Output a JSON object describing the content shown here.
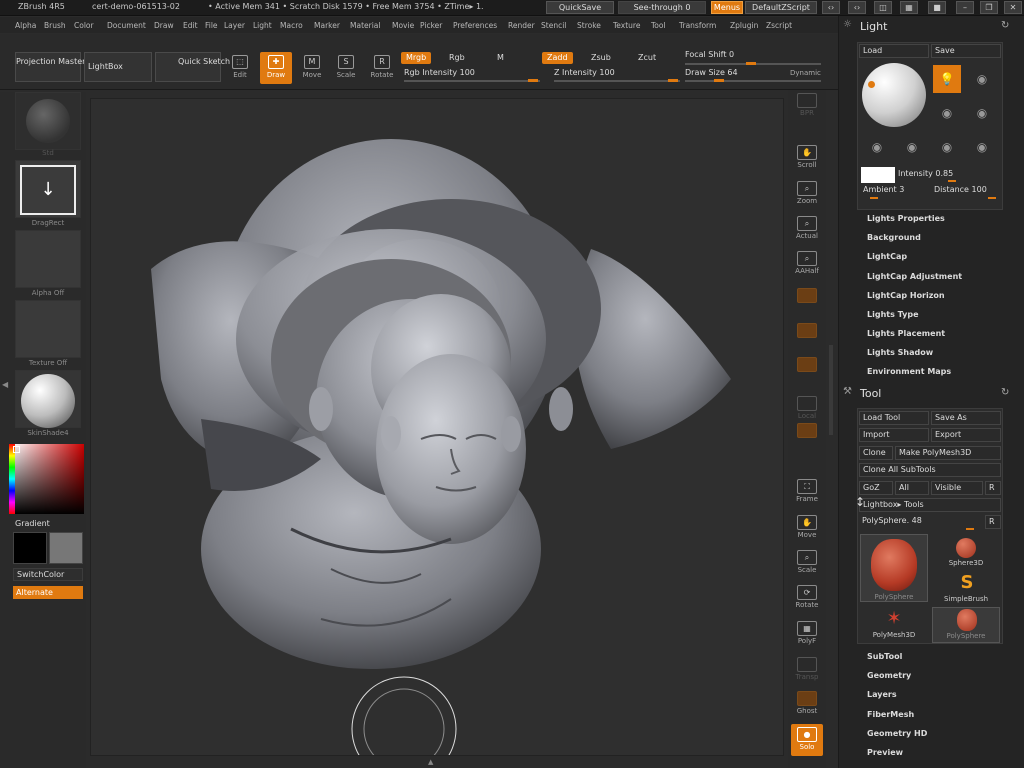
{
  "titlebar": {
    "app": "ZBrush 4R5",
    "doc": "cert-demo-061513-02",
    "stats": "• Active Mem 341 • Scratch Disk 1579 • Free Mem 3754 • ZTime▸ 1.",
    "quicksave": "QuickSave",
    "seethrough": "See-through  0",
    "menus": "Menus",
    "defaultzscript": "DefaultZScript"
  },
  "menus": [
    "Alpha",
    "Brush",
    "Color",
    "Document",
    "Draw",
    "Edit",
    "File",
    "Layer",
    "Light",
    "Macro",
    "Marker",
    "Material",
    "Movie",
    "Picker",
    "Preferences",
    "Render",
    "Stencil",
    "Stroke",
    "Texture",
    "Tool",
    "Transform",
    "Zplugin",
    "Zscript"
  ],
  "shelf": {
    "projection_master": "Projection Master",
    "lightbox": "LightBox",
    "quick_sketch": "Quick Sketch",
    "tools": [
      {
        "label": "Edit",
        "icon": "⬚"
      },
      {
        "label": "Draw",
        "icon": "✚"
      },
      {
        "label": "Move",
        "icon": "M"
      },
      {
        "label": "Scale",
        "icon": "S"
      },
      {
        "label": "Rotate",
        "icon": "R"
      }
    ],
    "mrgb": "Mrgb",
    "rgb": "Rgb",
    "m": "M",
    "zadd": "Zadd",
    "zsub": "Zsub",
    "zcut": "Zcut",
    "rgb_intensity": "Rgb  Intensity 100",
    "z_intensity": "Z  Intensity 100",
    "focal_shift": "Focal Shift 0",
    "draw_size": "Draw Size 64",
    "dynamic": "Dynamic"
  },
  "left": {
    "brush_label": "Std",
    "stroke_label": "DragRect",
    "alpha_label": "Alpha Off",
    "texture_label": "Texture Off",
    "material_label": "SkinShade4",
    "gradient": "Gradient",
    "switchcolor": "SwitchColor",
    "alternate": "Alternate"
  },
  "vtools": [
    {
      "label": "BPR",
      "icon": "",
      "dim": true
    },
    {
      "label": "Scroll",
      "icon": "✋"
    },
    {
      "label": "Zoom",
      "icon": "⌕"
    },
    {
      "label": "Actual",
      "icon": "⌕"
    },
    {
      "label": "AAHalf",
      "icon": "⌕"
    },
    {
      "label": "",
      "icon": "",
      "orange": true
    },
    {
      "label": "",
      "icon": "",
      "orange": true
    },
    {
      "label": "",
      "icon": "",
      "orange": true
    },
    {
      "label": "Local",
      "icon": "",
      "dim": true
    },
    {
      "label": "",
      "icon": "",
      "dim": true
    },
    {
      "label": "Frame",
      "icon": "⛶"
    },
    {
      "label": "Move",
      "icon": "✋"
    },
    {
      "label": "Scale",
      "icon": "⌕"
    },
    {
      "label": "Rotate",
      "icon": "⟳"
    },
    {
      "label": "PolyF",
      "icon": "▦"
    },
    {
      "label": "Transp",
      "icon": "",
      "dim": true
    },
    {
      "label": "Ghost",
      "icon": "",
      "orange": true
    },
    {
      "label": "Solo",
      "icon": "●"
    }
  ],
  "light": {
    "title": "Light",
    "load": "Load",
    "save": "Save",
    "intensity": "Intensity 0.85",
    "ambient": "Ambient 3",
    "distance": "Distance 100",
    "links": [
      "Lights Properties",
      "Background",
      "LightCap",
      "LightCap Adjustment",
      "LightCap Horizon",
      "Lights Type",
      "Lights Placement",
      "Lights Shadow",
      "Environment Maps"
    ]
  },
  "tool": {
    "title": "Tool",
    "load_tool": "Load Tool",
    "save_as": "Save As",
    "import": "Import",
    "export": "Export",
    "clone": "Clone",
    "make_polymesh": "Make PolyMesh3D",
    "clone_all": "Clone All SubTools",
    "goz": "GoZ",
    "all": "All",
    "visible": "Visible",
    "r": "R",
    "lightbox_tools": "Lightbox▸ Tools",
    "polysphere_slider": "PolySphere. 48",
    "thumbs": [
      {
        "label": "PolySphere"
      },
      {
        "label": "Sphere3D"
      },
      {
        "label": "SimpleBrush"
      },
      {
        "label": "PolyMesh3D"
      },
      {
        "label": "PolySphere"
      }
    ],
    "links": [
      "SubTool",
      "Geometry",
      "Layers",
      "FiberMesh",
      "Geometry HD",
      "Preview"
    ]
  },
  "colors": {
    "accent": "#e07a10"
  }
}
